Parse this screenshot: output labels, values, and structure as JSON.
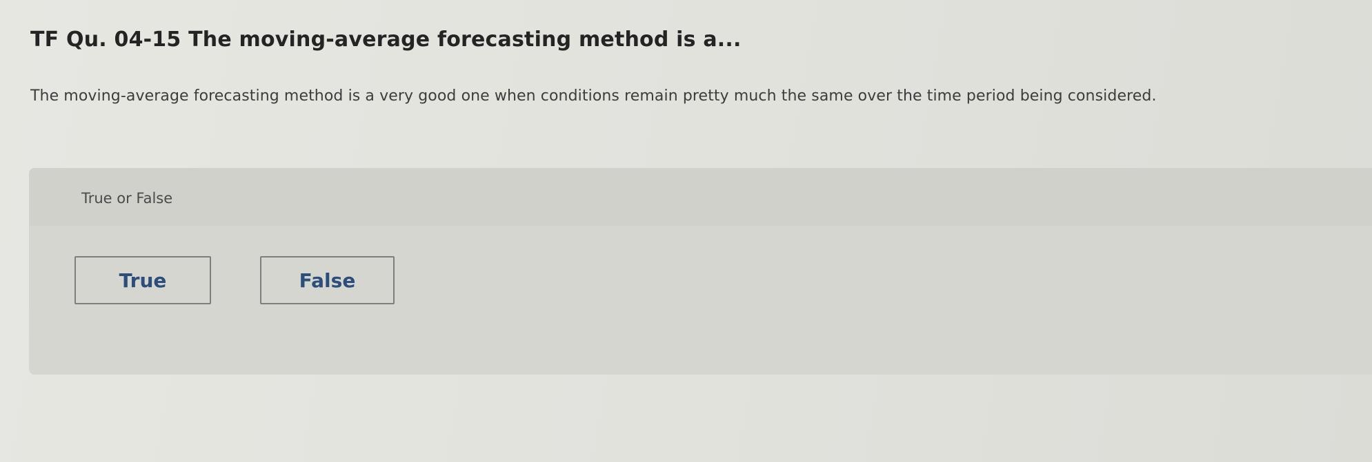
{
  "question": {
    "title": "TF Qu. 04-15 The moving-average forecasting method is a...",
    "body": "The moving-average forecasting method is a very good one when conditions remain pretty much the same over the time period being considered."
  },
  "answer": {
    "prompt": "True or False",
    "options": [
      {
        "label": "True"
      },
      {
        "label": "False"
      }
    ]
  },
  "colors": {
    "background": "#e2e2dd",
    "panel": "#d6d6d1",
    "button_text": "#2b4f7a",
    "button_border": "#7e7e7e"
  }
}
